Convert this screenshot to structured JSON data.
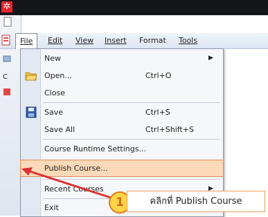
{
  "menubar": {
    "items": [
      {
        "label": "File"
      },
      {
        "label": "Edit"
      },
      {
        "label": "View"
      },
      {
        "label": "Insert"
      },
      {
        "label": "Format"
      },
      {
        "label": "Tools"
      }
    ]
  },
  "file_menu": {
    "items": [
      {
        "label": "New",
        "shortcut": "",
        "submenu": true
      },
      {
        "label": "Open...",
        "shortcut": "Ctrl+O"
      },
      {
        "label": "Close",
        "shortcut": ""
      },
      {
        "label": "Save",
        "shortcut": "Ctrl+S"
      },
      {
        "label": "Save All",
        "shortcut": "Ctrl+Shift+S"
      },
      {
        "label": "Course Runtime Settings...",
        "shortcut": ""
      },
      {
        "label": "Publish Course...",
        "shortcut": ""
      },
      {
        "label": "Recent Courses",
        "shortcut": "",
        "submenu": true
      },
      {
        "label": "Exit",
        "shortcut": ""
      }
    ]
  },
  "annotation": {
    "step_number": "1",
    "text": "คลิกที่ Publish Course"
  },
  "colors": {
    "highlight": "#fcd9b9",
    "arrow": "#e03030",
    "badge_fill": "#ffd447",
    "badge_border": "#e07c1f"
  }
}
